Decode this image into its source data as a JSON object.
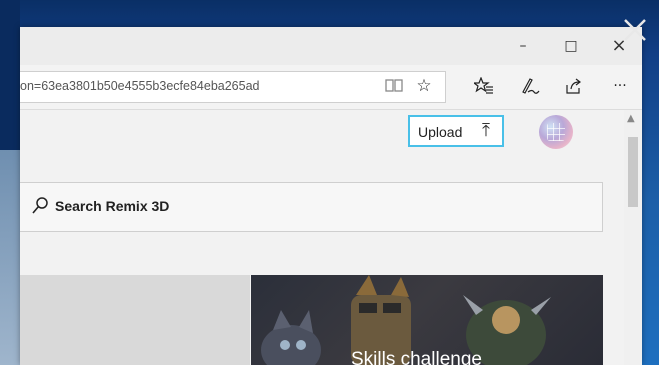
{
  "window": {
    "minimize_glyph": "–",
    "maximize_glyph": "□",
    "close_glyph": "×"
  },
  "address_bar": {
    "url": "on=63ea3801b50e4555b3ecfe84eba265ad"
  },
  "toolbar": {
    "reading_view_icon": "book-icon",
    "favorite_icon": "star-icon",
    "favorites_list_icon": "favorites-list-icon",
    "web_note_icon": "pen-icon",
    "share_icon": "share-icon",
    "more_label": "···"
  },
  "header": {
    "upload_label": "Upload",
    "upload_glyph": "⤒"
  },
  "search": {
    "label": "Search Remix 3D"
  },
  "tiles": {
    "skills_caption": "Skills challenge"
  },
  "scrollbar": {
    "up_glyph": "▲"
  },
  "colors": {
    "upload_border": "#49c0e8",
    "desktop_blue": "#1c5fa8"
  }
}
